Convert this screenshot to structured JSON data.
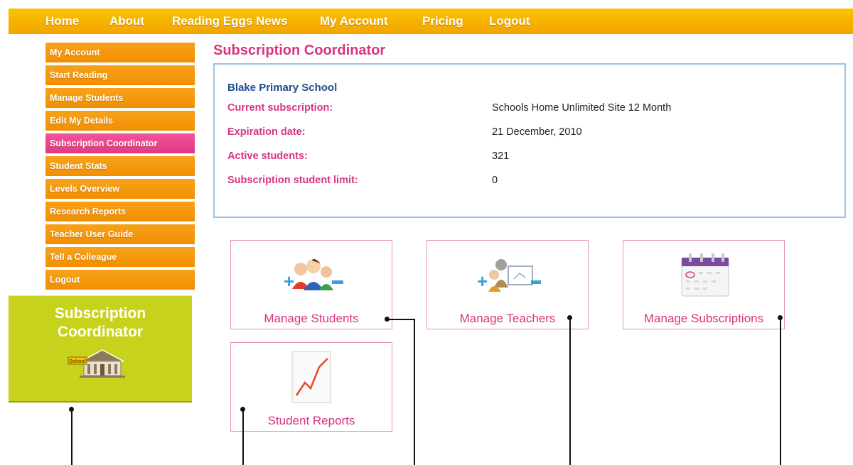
{
  "nav": {
    "items": [
      "Home",
      "About",
      "Reading Eggs News",
      "My Account",
      "Pricing",
      "Logout"
    ]
  },
  "sidebar": {
    "items": [
      {
        "label": "My Account"
      },
      {
        "label": "Start Reading"
      },
      {
        "label": "Manage Students"
      },
      {
        "label": "Edit My Details"
      },
      {
        "label": "Subscription Coordinator",
        "active": true
      },
      {
        "label": "Student Stats"
      },
      {
        "label": "Levels Overview"
      },
      {
        "label": "Research Reports"
      },
      {
        "label": "Teacher User Guide"
      },
      {
        "label": "Tell a Colleague"
      },
      {
        "label": "Logout"
      }
    ],
    "promo": {
      "title_line1": "Subscription",
      "title_line2": "Coordinator",
      "icon_text": "School"
    }
  },
  "main": {
    "title": "Subscription Coordinator",
    "school_name": "Blake Primary School",
    "details": [
      {
        "label": "Current subscription:",
        "value": "Schools Home Unlimited Site 12 Month"
      },
      {
        "label": "Expiration date:",
        "value": "21 December, 2010"
      },
      {
        "label": "Active students:",
        "value": "321"
      },
      {
        "label": "Subscription student limit:",
        "value": "0"
      }
    ],
    "tiles": [
      {
        "label": "Manage Students"
      },
      {
        "label": "Manage Teachers"
      },
      {
        "label": "Manage Subscriptions"
      },
      {
        "label": "Student Reports"
      }
    ]
  },
  "colors": {
    "nav_bg": "#f7b500",
    "sidebar_item": "#f39200",
    "sidebar_active": "#e23883",
    "accent_pink": "#d9347f",
    "promo_green": "#c7d21c",
    "info_border": "#9cc3e6"
  }
}
